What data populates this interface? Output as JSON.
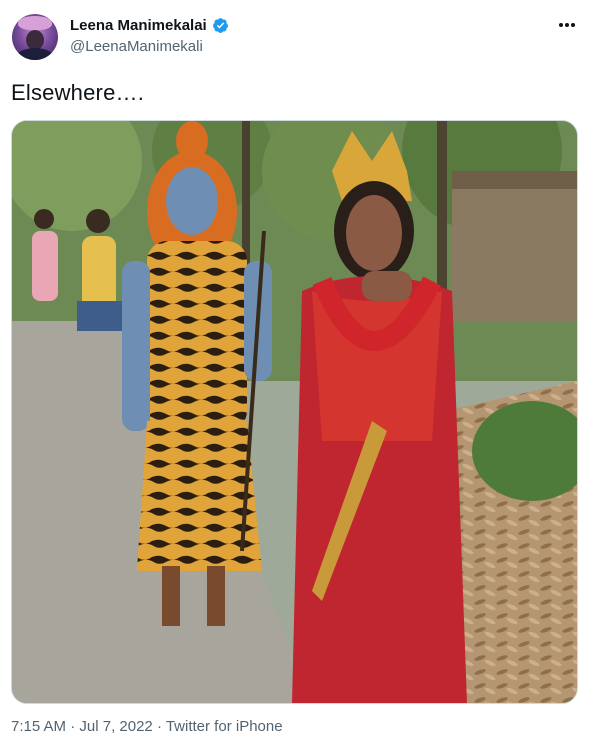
{
  "author": {
    "display_name": "Leena Manimekalai",
    "handle": "@LeenaManimekali",
    "verified": true,
    "avatar_icon": "profile-photo"
  },
  "tweet": {
    "text": "Elsewhere….",
    "media": {
      "type": "photo"
    }
  },
  "meta": {
    "time": "7:15 AM",
    "separator": " · ",
    "date": "Jul 7, 2022",
    "source": "Twitter for iPhone"
  },
  "colors": {
    "verified_blue": "#1d9bf0",
    "secondary_text": "#536471",
    "primary_text": "#0f1419",
    "border": "#cfd9de"
  },
  "icons": {
    "more": "more-horizontal-icon",
    "verified": "verified-badge-icon"
  }
}
